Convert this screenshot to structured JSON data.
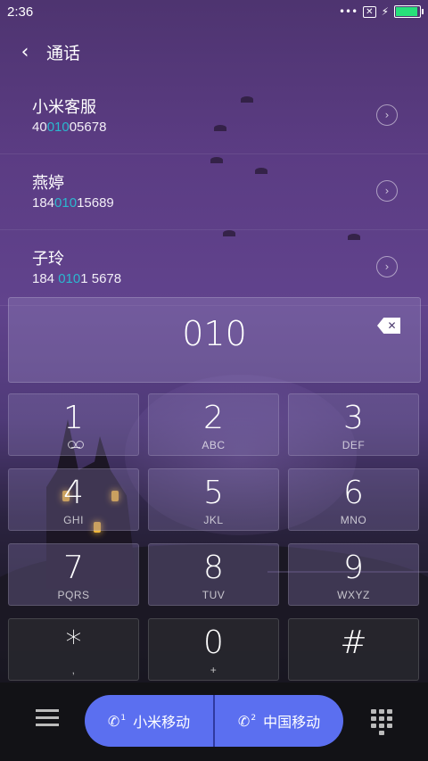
{
  "status": {
    "time": "2:36",
    "icons": [
      "dots-icon",
      "notification-x-icon",
      "charging-icon",
      "battery-icon"
    ],
    "battery_color": "#27e07a"
  },
  "header": {
    "title": "通话",
    "back_icon": "chevron-left-icon"
  },
  "contacts": [
    {
      "name": "小米客服",
      "number_pre": "40",
      "number_match": "010",
      "number_post": "05678"
    },
    {
      "name": "燕婷",
      "number_pre": "184",
      "number_match": "010",
      "number_post": "15689"
    },
    {
      "name": "子玲",
      "number_pre": "184 ",
      "number_match": "010",
      "number_post": "1 5678"
    }
  ],
  "highlight_color": "#2bb8cf",
  "dial": {
    "digits": "010"
  },
  "keypad": [
    {
      "digit": "1",
      "letters": ""
    },
    {
      "digit": "2",
      "letters": "ABC"
    },
    {
      "digit": "3",
      "letters": "DEF"
    },
    {
      "digit": "4",
      "letters": "GHI"
    },
    {
      "digit": "5",
      "letters": "JKL"
    },
    {
      "digit": "6",
      "letters": "MNO"
    },
    {
      "digit": "7",
      "letters": "PQRS"
    },
    {
      "digit": "8",
      "letters": "TUV"
    },
    {
      "digit": "9",
      "letters": "WXYZ"
    },
    {
      "digit": "*",
      "letters": ","
    },
    {
      "digit": "0",
      "letters": "+"
    },
    {
      "digit": "#",
      "letters": ""
    }
  ],
  "bottom": {
    "sim1_label": "小米移动",
    "sim1_index": "1",
    "sim2_label": "中国移动",
    "sim2_index": "2",
    "call_color": "#5b6ff0"
  }
}
